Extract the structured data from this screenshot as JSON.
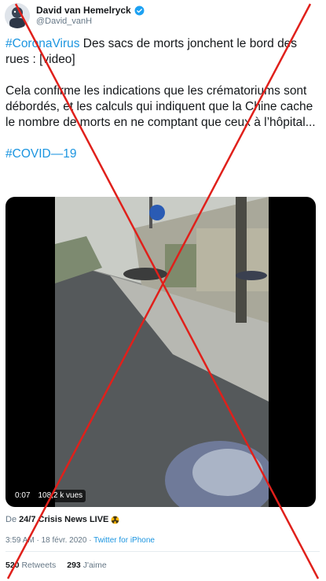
{
  "author": {
    "name": "David van Hemelryck",
    "handle": "@David_vanH",
    "avatar_icon": "avatar-image",
    "verified_icon": "verified-badge-icon"
  },
  "tweet": {
    "line1_hashtag": "#CoronaVirus",
    "line1_text": " Des sacs de morts jonchent le bord des rues : [video]",
    "paragraph2": "Cela confirme les indications que les crématoriums sont débordés, et les calculs qui indiquent que la Chine cache le nombre de morts en ne comptant que ceux à l’hôpital...",
    "hashtag2": "#COVID—19"
  },
  "video": {
    "timestamp": "0:07",
    "views": "108,2 k vues"
  },
  "source": {
    "prefix": "De",
    "name": "24/7 Crisis News LIVE",
    "emoji_icon": "radioactive-emoji-icon"
  },
  "meta": {
    "time": "3:59 AM",
    "separator1": " · ",
    "date": "18 févr. 2020",
    "separator2": " · ",
    "app": "Twitter for iPhone"
  },
  "stats": {
    "retweets_count": "520",
    "retweets_label": "Retweets",
    "likes_count": "293",
    "likes_label": "J'aime"
  },
  "colors": {
    "link": "#1b95e0",
    "secondary_text": "#657786",
    "cross": "#e0201b"
  }
}
